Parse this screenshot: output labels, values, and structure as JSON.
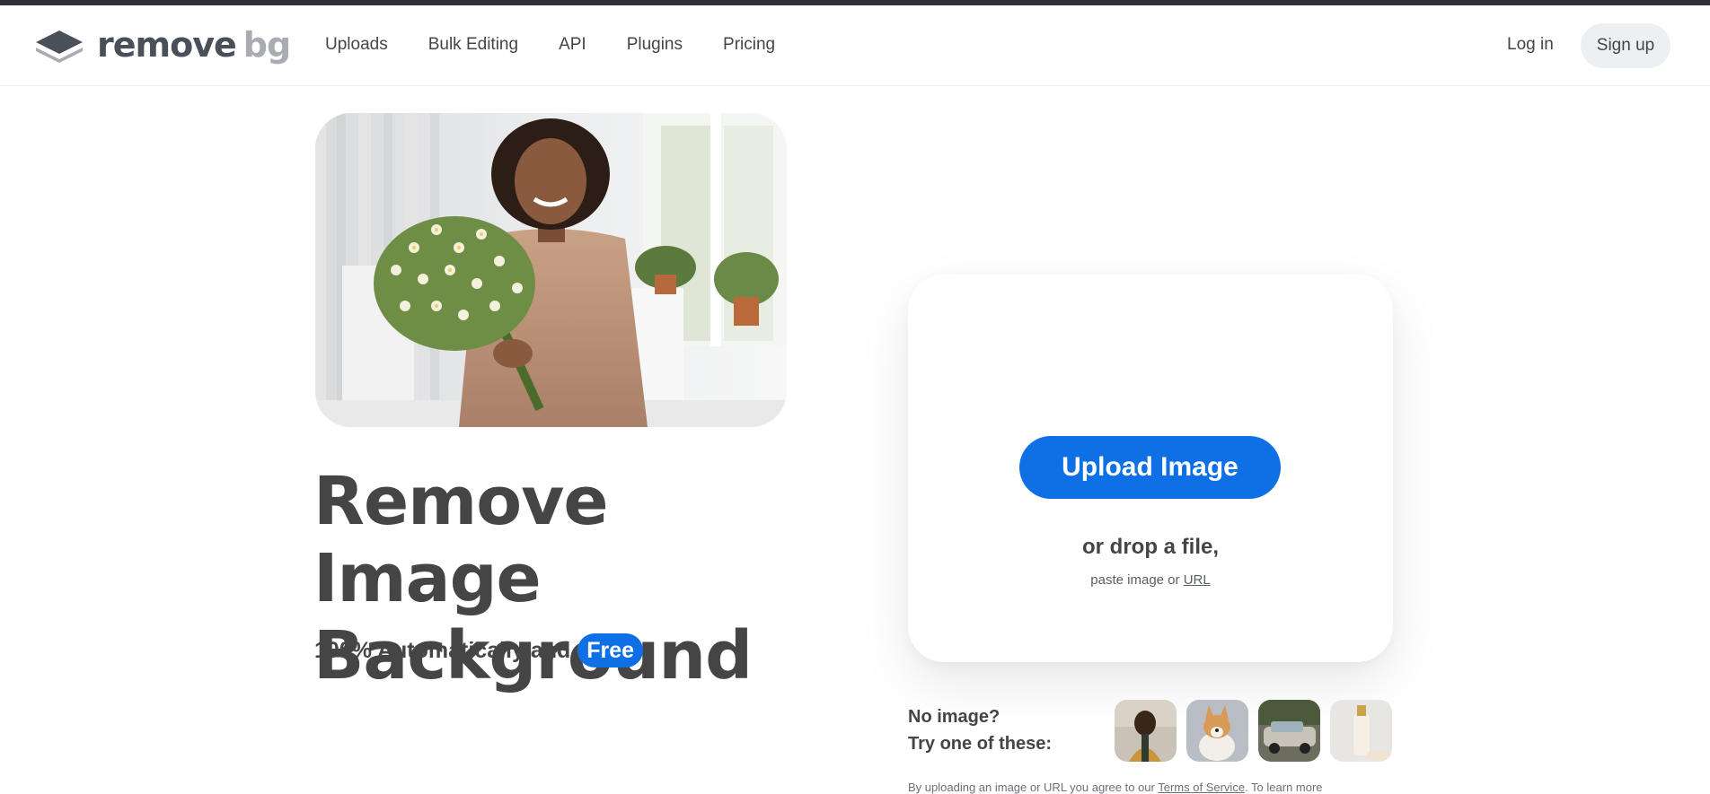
{
  "brand": {
    "logo_word_main": "remove",
    "logo_word_bg": "bg",
    "colors": {
      "primary_blue": "#0f70e6",
      "text_dark": "#454545",
      "logo_gray_dark": "#4a5059",
      "logo_gray_light": "#a9adb3",
      "signup_bg": "#edf0f2"
    }
  },
  "nav": {
    "links": [
      {
        "label": "Uploads"
      },
      {
        "label": "Bulk Editing"
      },
      {
        "label": "API"
      },
      {
        "label": "Plugins"
      },
      {
        "label": "Pricing"
      }
    ],
    "login_label": "Log in",
    "signup_label": "Sign up"
  },
  "hero": {
    "headline": "Remove Image Background",
    "sub_prefix": "100% Automatically and",
    "sub_badge": "Free"
  },
  "upload": {
    "button_label": "Upload Image",
    "drop_text": "or drop a file,",
    "paste_prefix": "paste image or",
    "paste_link": "URL"
  },
  "samples": {
    "line1": "No image?",
    "line2": "Try one of these:",
    "items": [
      {
        "icon": "person-sample-thumbnail"
      },
      {
        "icon": "dog-sample-thumbnail"
      },
      {
        "icon": "car-sample-thumbnail"
      },
      {
        "icon": "product-sample-thumbnail"
      }
    ]
  },
  "legal": {
    "text_start": "By uploading an image or URL you agree to our",
    "terms_link": "Terms of Service",
    "text_end": ". To learn more"
  }
}
